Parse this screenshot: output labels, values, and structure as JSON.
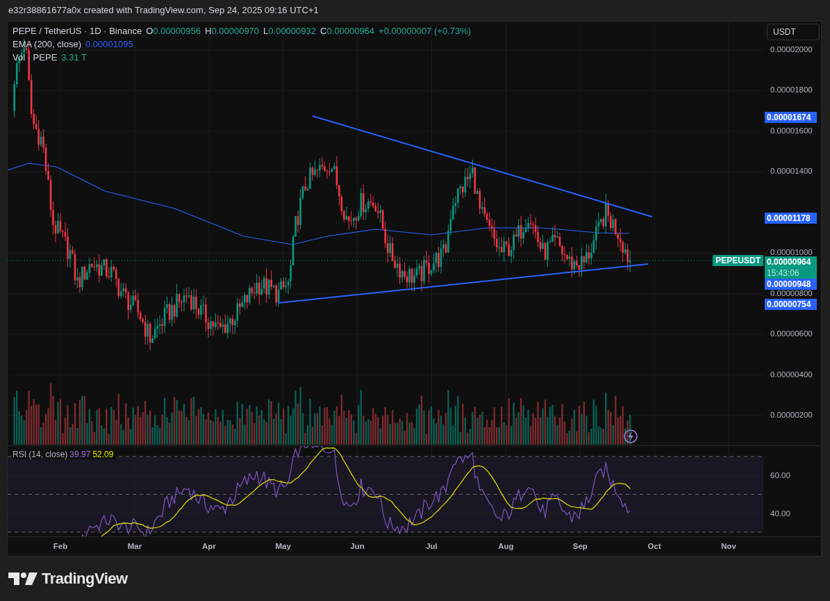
{
  "header": {
    "text": "e32r38861677a0x created with TradingView.com, Sep 24, 2025 09:16 UTC+1"
  },
  "legend": {
    "symbol": "PEPE / TetherUS · 1D · Binance",
    "ohlc": [
      {
        "label": "O",
        "value": "0.00000956"
      },
      {
        "label": "H",
        "value": "0.00000970"
      },
      {
        "label": "L",
        "value": "0.00000932"
      },
      {
        "label": "C",
        "value": "0.00000964"
      }
    ],
    "change": "+0.00000007 (+0.73%)",
    "ema_label": "EMA (200, close)",
    "ema_value": "0.00001095",
    "vol_label": "Vol · PEPE",
    "vol_value": "3.31 T"
  },
  "currency_button": "USDT",
  "price_axis": [
    "0.00002000",
    "0.00001800",
    "0.00001600",
    "0.00001400",
    "0.00001000",
    "0.00000800",
    "0.00000600",
    "0.00000400",
    "0.00000200"
  ],
  "price_badges": [
    "0.00001674",
    "0.00001178",
    "0.00000948",
    "0.00000754"
  ],
  "last_price": {
    "symbol": "PEPEUSDT",
    "price": "0.00000964",
    "countdown": "15:43:06"
  },
  "rsi": {
    "label": "RSI (14, close)",
    "value": "39.97",
    "ma_value": "52.09",
    "axis": [
      "60.00",
      "40.00"
    ]
  },
  "time_axis": [
    "Feb",
    "Mar",
    "Apr",
    "May",
    "Jun",
    "Jul",
    "Aug",
    "Sep",
    "Oct",
    "Nov"
  ],
  "logo": "TradingView"
}
